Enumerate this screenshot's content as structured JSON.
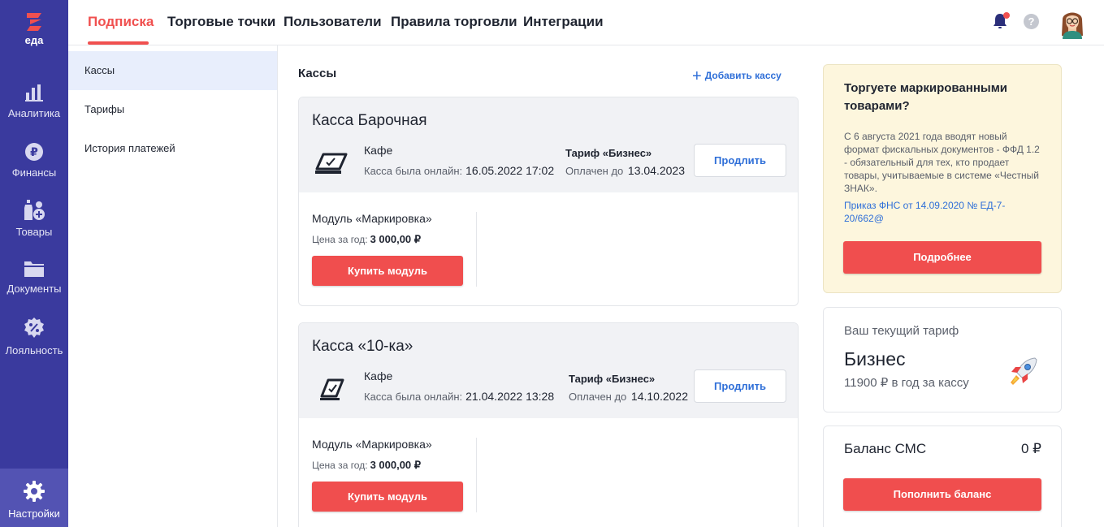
{
  "brand": {
    "logo_text": "еда",
    "accent": "#f0504f",
    "rail_color": "#3a3a9e"
  },
  "rail": {
    "items": [
      {
        "label": "Аналитика",
        "icon": "bar-chart-icon"
      },
      {
        "label": "Финансы",
        "icon": "ruble-coin-icon"
      },
      {
        "label": "Товары",
        "icon": "goods-icon"
      },
      {
        "label": "Документы",
        "icon": "folder-icon"
      },
      {
        "label": "Лояльность",
        "icon": "discount-badge-icon"
      }
    ],
    "settings_label": "Настройки"
  },
  "tabs": [
    {
      "label": "Подписка",
      "active": true
    },
    {
      "label": "Торговые точки"
    },
    {
      "label": "Пользователи"
    },
    {
      "label": "Правила торговли"
    },
    {
      "label": "Интеграции"
    }
  ],
  "header": {
    "help_glyph": "?"
  },
  "submenu": [
    {
      "label": "Кассы",
      "active": true
    },
    {
      "label": "Тарифы"
    },
    {
      "label": "История платежей"
    }
  ],
  "main": {
    "title": "Кассы",
    "add_label": "Добавить кассу",
    "cards": [
      {
        "title": "Касса Барочная",
        "venue": "Кафе",
        "online_label": "Касса была онлайн:",
        "online_value": "16.05.2022 17:02",
        "tariff": "Тариф «Бизнес»",
        "paid_label": "Оплачен до",
        "paid_value": "13.04.2023",
        "renew_label": "Продлить",
        "module_title": "Модуль «Маркировка»",
        "module_price_label": "Цена за год:",
        "module_price_value": "3 000,00 ₽",
        "buy_label": "Купить модуль"
      },
      {
        "title": "Касса «10-ка»",
        "venue": "Кафе",
        "online_label": "Касса была онлайн:",
        "online_value": "21.04.2022 13:28",
        "tariff": "Тариф «Бизнес»",
        "paid_label": "Оплачен до",
        "paid_value": "14.10.2022",
        "renew_label": "Продлить",
        "module_title": "Модуль «Маркировка»",
        "module_price_label": "Цена за год:",
        "module_price_value": "3 000,00 ₽",
        "buy_label": "Купить модуль"
      }
    ]
  },
  "promo": {
    "title": "Торгуете маркированными товарами?",
    "text": "С 6 августа 2021 года вводят новый формат фискальных документов - ФФД 1.2 - обязательный для тех, кто продает товары, учитываемые в системе «Честный ЗНАК».",
    "link": "Приказ ФНС от 14.09.2020 № ЕД-7-20/662@",
    "button": "Подробнее"
  },
  "plan": {
    "label": "Ваш текущий тариф",
    "name": "Бизнес",
    "price": "11900 ₽ в год за кассу"
  },
  "sms": {
    "label": "Баланс СМС",
    "value": "0 ₽",
    "button": "Пополнить баланс"
  }
}
